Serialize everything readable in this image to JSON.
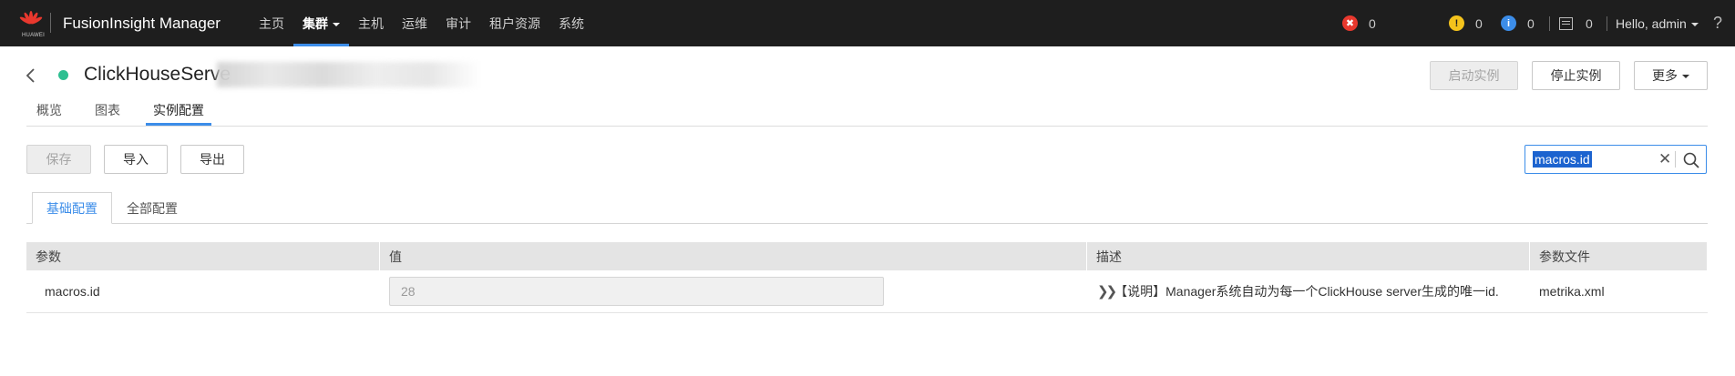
{
  "brand": {
    "logo_text": "HUAWEI",
    "app_title": "FusionInsight Manager"
  },
  "nav": {
    "items": [
      {
        "label": "主页"
      },
      {
        "label": "集群",
        "active": true,
        "dropdown": true
      },
      {
        "label": "主机"
      },
      {
        "label": "运维"
      },
      {
        "label": "审计"
      },
      {
        "label": "租户资源"
      },
      {
        "label": "系统"
      }
    ]
  },
  "alarms": {
    "critical": "0",
    "major": "0",
    "info": "0",
    "tasks": "0"
  },
  "user": {
    "greeting": "Hello, admin"
  },
  "instance": {
    "name": "ClickHouseServe",
    "status_color": "#2ebf91"
  },
  "actions": {
    "start": "启动实例",
    "stop": "停止实例",
    "more": "更多"
  },
  "subtabs": {
    "overview": "概览",
    "charts": "图表",
    "config": "实例配置"
  },
  "toolbar": {
    "save": "保存",
    "import": "导入",
    "export": "导出"
  },
  "search": {
    "value": "macros.id"
  },
  "config_tabs": {
    "basic": "基础配置",
    "all": "全部配置"
  },
  "table": {
    "headers": [
      "参数",
      "值",
      "描述",
      "参数文件"
    ],
    "rows": [
      {
        "param": "macros.id",
        "value": "28",
        "desc": "【说明】Manager系统自动为每一个ClickHouse server生成的唯一id.",
        "file": "metrika.xml"
      }
    ]
  },
  "colors": {
    "accent": "#3c8de9",
    "topbar": "#1e1e1e",
    "critical": "#e8382e",
    "major": "#f4c31c",
    "info": "#3c8de9"
  }
}
